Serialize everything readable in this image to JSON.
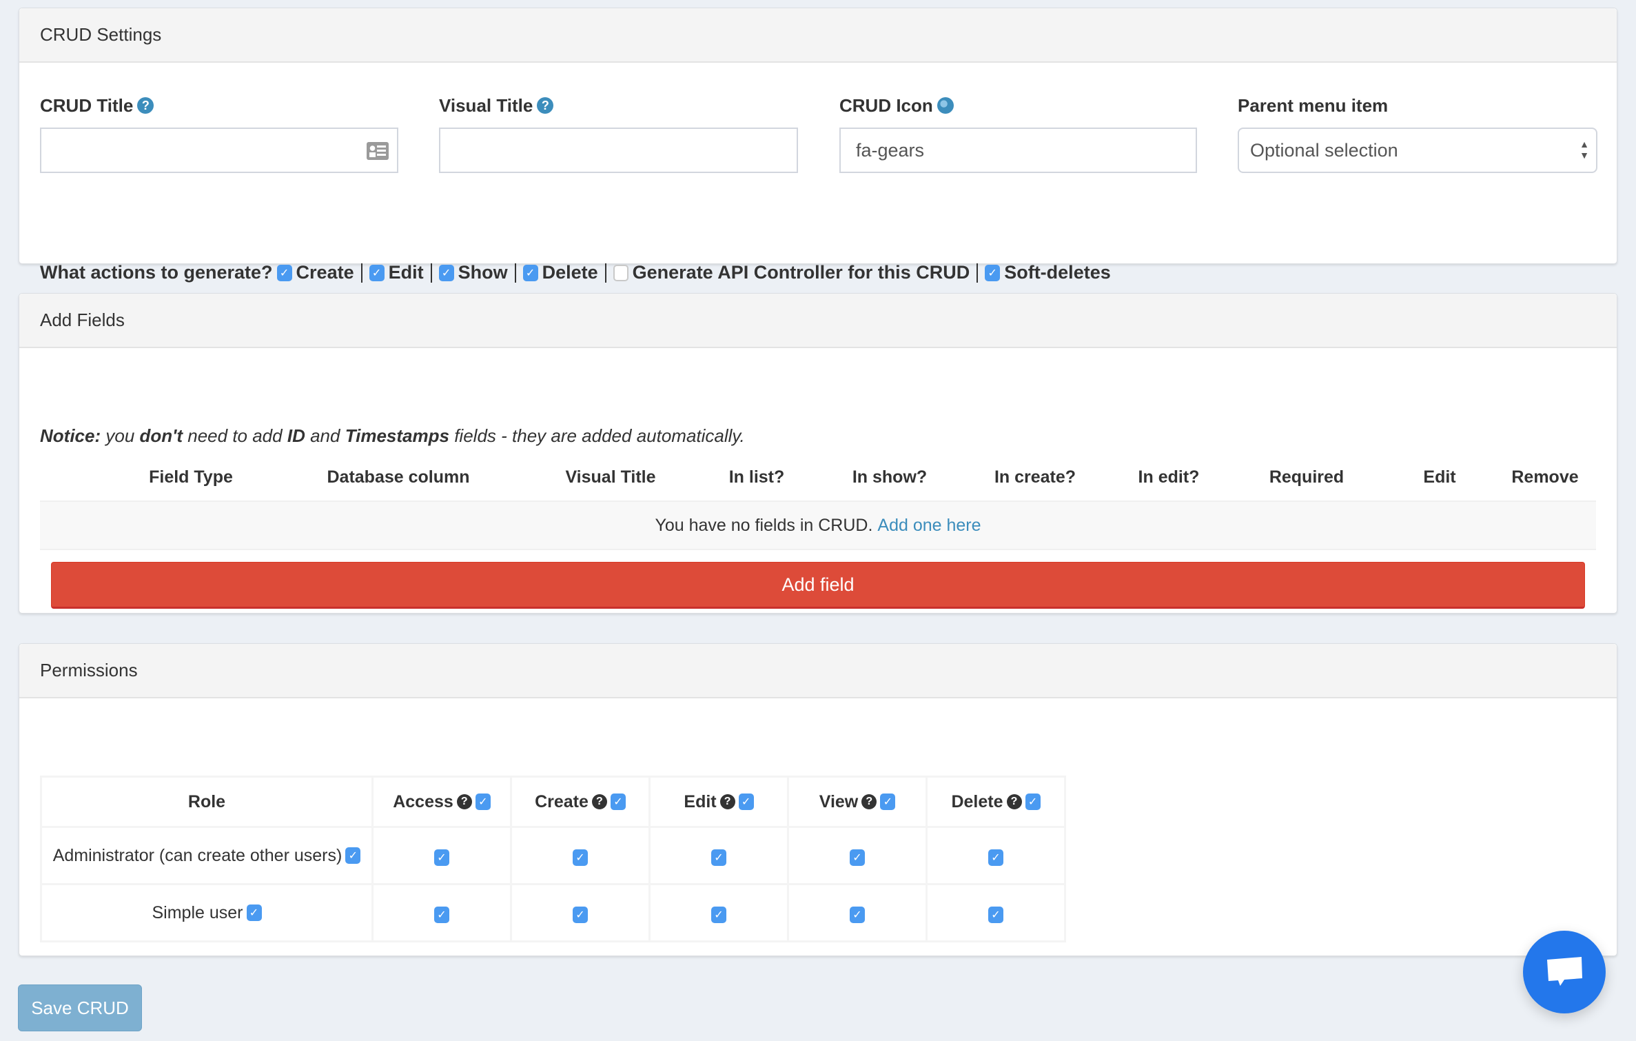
{
  "crud_settings": {
    "heading": "CRUD Settings",
    "crud_title": {
      "label": "CRUD Title",
      "value": "",
      "help": "?"
    },
    "visual_title": {
      "label": "Visual Title",
      "value": "",
      "help": "?"
    },
    "crud_icon": {
      "label": "CRUD Icon",
      "value": "fa-gears"
    },
    "parent_menu": {
      "label": "Parent menu item",
      "selected": "Optional selection"
    },
    "actions": {
      "label": "What actions to generate?",
      "items": [
        {
          "label": "Create",
          "checked": true
        },
        {
          "label": "Edit",
          "checked": true
        },
        {
          "label": "Show",
          "checked": true
        },
        {
          "label": "Delete",
          "checked": true
        },
        {
          "label": "Generate API Controller for this CRUD",
          "checked": false
        },
        {
          "label": "Soft-deletes",
          "checked": true
        }
      ]
    }
  },
  "add_fields": {
    "heading": "Add Fields",
    "notice": {
      "prefix": "Notice:",
      "t1": "you",
      "b1": "don't",
      "t2": "need to add",
      "b2": "ID",
      "t3": "and",
      "b3": "Timestamps",
      "t4": "fields - they are added automatically."
    },
    "columns": [
      "Field Type",
      "Database column",
      "Visual Title",
      "In list?",
      "In show?",
      "In create?",
      "In edit?",
      "Required",
      "Edit",
      "Remove"
    ],
    "empty_text": "You have no fields in CRUD.",
    "empty_link": "Add one here",
    "add_button": "Add field"
  },
  "permissions": {
    "heading": "Permissions",
    "columns": [
      {
        "label": "Role"
      },
      {
        "label": "Access",
        "help": "?",
        "checked": true
      },
      {
        "label": "Create",
        "help": "?",
        "checked": true
      },
      {
        "label": "Edit",
        "help": "?",
        "checked": true
      },
      {
        "label": "View",
        "help": "?",
        "checked": true
      },
      {
        "label": "Delete",
        "help": "?",
        "checked": true
      }
    ],
    "rows": [
      {
        "role": "Administrator (can create other users)",
        "role_checked": true,
        "access": true,
        "create": true,
        "edit": true,
        "view": true,
        "delete": true
      },
      {
        "role": "Simple user",
        "role_checked": true,
        "access": true,
        "create": true,
        "edit": true,
        "view": true,
        "delete": true
      }
    ]
  },
  "save_button": "Save CRUD",
  "chat_widget": {
    "icon": "chat-bubble-icon"
  },
  "colors": {
    "accent": "#3c8dbc",
    "danger": "#dd4b39",
    "checkbox": "#4a9af1",
    "chat": "#2377eb",
    "save_disabled": "#7eb0d1"
  },
  "check_glyph": "✓"
}
